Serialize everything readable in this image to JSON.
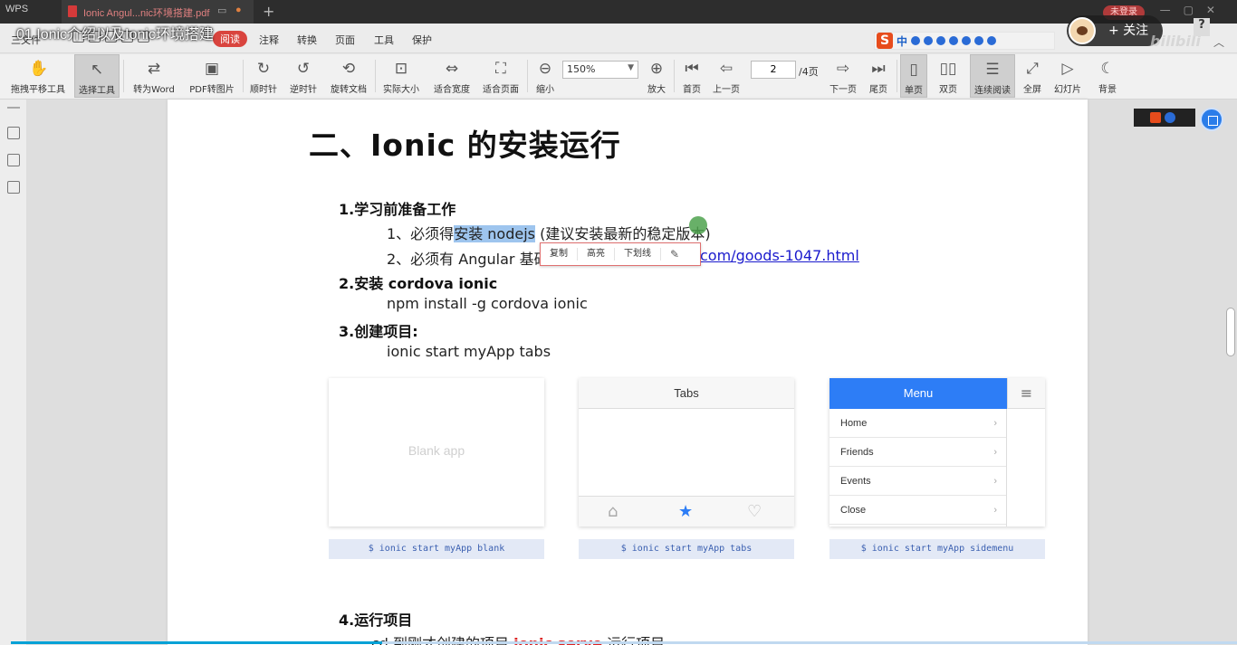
{
  "tabbar": {
    "app_name": "WPS",
    "doc_tab_label": "Ionic Angul...nic环境搭建.pdf",
    "login_label": "未登录"
  },
  "video": {
    "title": "01 Ionic介绍以及Ionic环境搭建",
    "follow_label": "+ 关注",
    "help_label": "?",
    "watermark": "bilibili"
  },
  "menubar": {
    "file": "三文件",
    "items": [
      "阅读",
      "注释",
      "转换",
      "页面",
      "工具",
      "保护"
    ],
    "ime": {
      "logo": "S",
      "lang": "中"
    }
  },
  "toolbar": {
    "hand": "拖拽平移工具",
    "select": "选择工具",
    "to_word": "转为Word",
    "pdf_to_image": "PDF转图片",
    "clockwise": "顺时针",
    "counterclockwise": "逆时针",
    "rotate_doc": "旋转文档",
    "actual_size": "实际大小",
    "fit_width": "适合宽度",
    "fit_page": "适合页面",
    "zoom_out": "缩小",
    "zoom_value": "150%",
    "zoom_in": "放大",
    "first_page": "首页",
    "prev_page": "上一页",
    "current_page": "2",
    "total_pages": "/4页",
    "next_page": "下一页",
    "last_page": "尾页",
    "single_page": "单页",
    "double_page": "双页",
    "continuous": "连续阅读",
    "fullscreen": "全屏",
    "slideshow": "幻灯片",
    "background": "背景"
  },
  "document": {
    "heading": "二、Ionic 的安装运行",
    "s1_title": "1.学习前准备工作",
    "s1_l1_prefix": "1、必须得",
    "s1_l1_highlight": "安装 nodejs",
    "s1_l1_suffix": " (建议安装最新的稳定版本)",
    "s1_l2_prefix": "2、必须有 Angular 基础",
    "s1_l2_link": "com/goods-1047.html",
    "s2_title": "2.安装 cordova ionic",
    "s2_cmd": "npm install -g cordova ionic",
    "s3_title": "3.创建项目:",
    "s3_cmd": "ionic start myApp tabs",
    "s4_title": "4.运行项目",
    "s4_line_a": "cd  到刚才创建的项目  ",
    "s4_line_cmd": "ionic serve",
    "s4_line_b": " 运行项目"
  },
  "context_menu": {
    "copy": "复制",
    "highlight": "高亮",
    "underline": "下划线"
  },
  "cards": {
    "blank_label": "Blank app",
    "tabs_header": "Tabs",
    "menu_header": "Menu",
    "menu_items": [
      "Home",
      "Friends",
      "Events",
      "Close"
    ],
    "cmd_blank": "$ ionic start myApp blank",
    "cmd_tabs": "$ ionic start myApp tabs",
    "cmd_sidemenu": "$ ionic start myApp sidemenu"
  },
  "colors": {
    "accent_red": "#d9443e",
    "highlight_blue": "#9ec5ee",
    "menu_blue": "#2d7df6",
    "tab_star": "#2d7df6"
  }
}
